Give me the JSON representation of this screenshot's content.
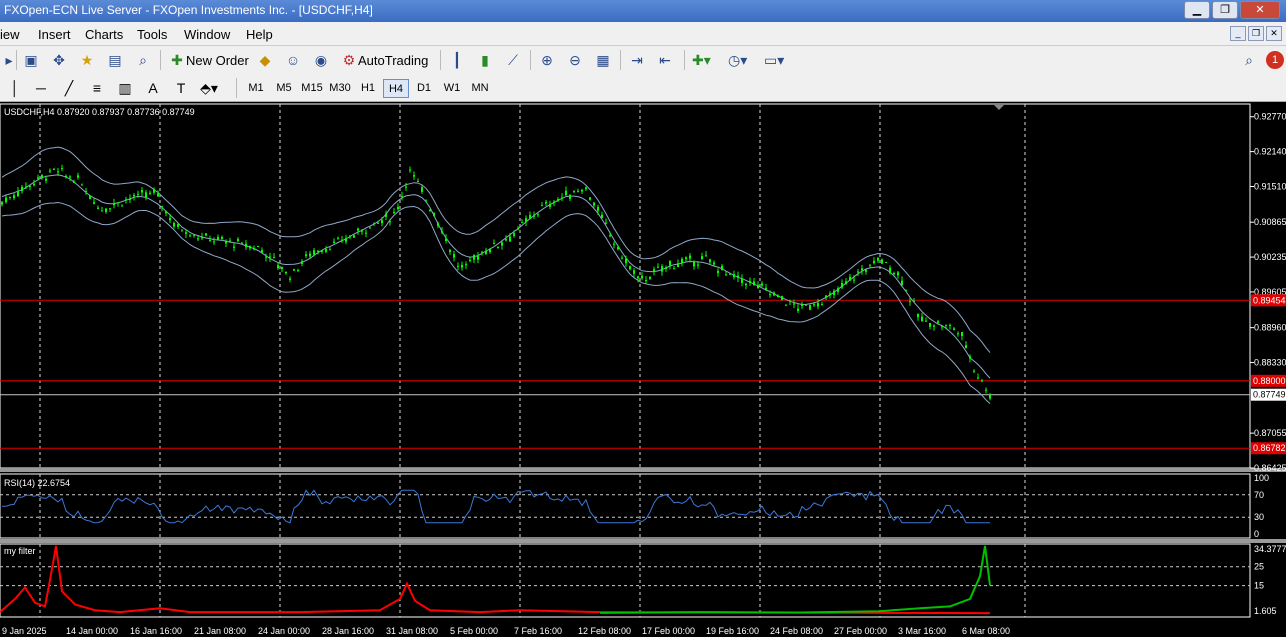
{
  "window": {
    "title": "FXOpen-ECN Live Server - FXOpen Investments Inc. - [USDCHF,H4]"
  },
  "menu": [
    "iew",
    "Insert",
    "Charts",
    "Tools",
    "Window",
    "Help"
  ],
  "toolbar": {
    "new_order": "New Order",
    "auto_trading": "AutoTrading",
    "notification_count": "1"
  },
  "timeframes": [
    "M1",
    "M5",
    "M15",
    "M30",
    "H1",
    "H4",
    "D1",
    "W1",
    "MN"
  ],
  "active_timeframe": "H4",
  "chart": {
    "header": "USDCHF,H4  0.87920 0.87937 0.87736 0.87749",
    "price_labels": [
      "0.92770",
      "0.92140",
      "0.91510",
      "0.90865",
      "0.90235",
      "0.89605",
      "0.88960",
      "0.88330",
      "0.87055",
      "0.86425"
    ],
    "current_price": "0.87749",
    "hline_labels": [
      "0.89454",
      "0.88000",
      "0.86782"
    ],
    "time_labels": [
      "9 Jan 2025",
      "14 Jan 00:00",
      "16 Jan 16:00",
      "21 Jan 08:00",
      "24 Jan 00:00",
      "28 Jan 16:00",
      "31 Jan 08:00",
      "5 Feb 00:00",
      "7 Feb 16:00",
      "12 Feb 08:00",
      "17 Feb 00:00",
      "19 Feb 16:00",
      "24 Feb 08:00",
      "27 Feb 00:00",
      "3 Mar 16:00",
      "6 Mar 08:00"
    ]
  },
  "rsi": {
    "label": "RSI(14) 22.6754",
    "levels": [
      "100",
      "70",
      "30",
      "0"
    ]
  },
  "filter": {
    "label": "my filter",
    "levels": [
      "34.3777",
      "25",
      "15",
      "1.605"
    ]
  },
  "colors": {
    "candle": "#00ff00",
    "bands": "#8fa8c8",
    "hline": "#e00000",
    "rsi_line": "#3a78d8",
    "filter_red": "#ff0000",
    "filter_green": "#00c000"
  }
}
